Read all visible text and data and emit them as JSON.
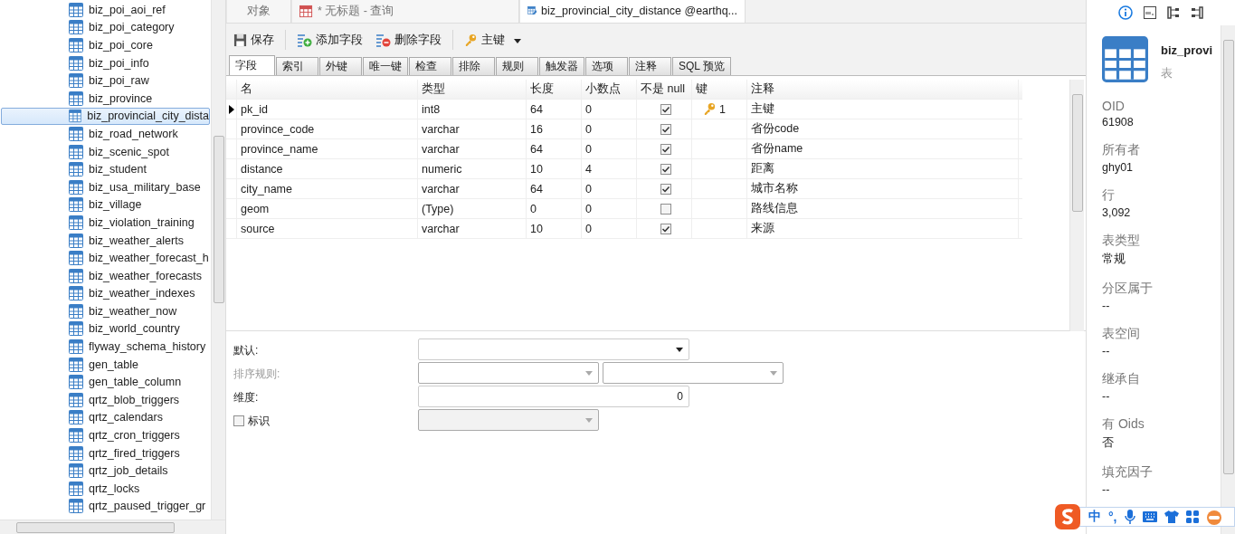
{
  "sidebar": {
    "items": [
      {
        "label": "biz_poi_aoi_ref",
        "selected": false
      },
      {
        "label": "biz_poi_category",
        "selected": false
      },
      {
        "label": "biz_poi_core",
        "selected": false
      },
      {
        "label": "biz_poi_info",
        "selected": false
      },
      {
        "label": "biz_poi_raw",
        "selected": false
      },
      {
        "label": "biz_province",
        "selected": false
      },
      {
        "label": "biz_provincial_city_dista",
        "selected": true
      },
      {
        "label": "biz_road_network",
        "selected": false
      },
      {
        "label": "biz_scenic_spot",
        "selected": false
      },
      {
        "label": "biz_student",
        "selected": false
      },
      {
        "label": "biz_usa_military_base",
        "selected": false
      },
      {
        "label": "biz_village",
        "selected": false
      },
      {
        "label": "biz_violation_training",
        "selected": false
      },
      {
        "label": "biz_weather_alerts",
        "selected": false
      },
      {
        "label": "biz_weather_forecast_h",
        "selected": false
      },
      {
        "label": "biz_weather_forecasts",
        "selected": false
      },
      {
        "label": "biz_weather_indexes",
        "selected": false
      },
      {
        "label": "biz_weather_now",
        "selected": false
      },
      {
        "label": "biz_world_country",
        "selected": false
      },
      {
        "label": "flyway_schema_history",
        "selected": false
      },
      {
        "label": "gen_table",
        "selected": false
      },
      {
        "label": "gen_table_column",
        "selected": false
      },
      {
        "label": "qrtz_blob_triggers",
        "selected": false
      },
      {
        "label": "qrtz_calendars",
        "selected": false
      },
      {
        "label": "qrtz_cron_triggers",
        "selected": false
      },
      {
        "label": "qrtz_fired_triggers",
        "selected": false
      },
      {
        "label": "qrtz_job_details",
        "selected": false
      },
      {
        "label": "qrtz_locks",
        "selected": false
      },
      {
        "label": "qrtz_paused_trigger_gr",
        "selected": false
      }
    ]
  },
  "doc_tabs": [
    {
      "label": "对象",
      "kind": "plain",
      "selected": false
    },
    {
      "label": "* 无标题 - 查询",
      "kind": "query",
      "selected": false
    },
    {
      "label": "biz_provincial_city_distance @earthq...",
      "kind": "table",
      "selected": true
    }
  ],
  "toolbar": [
    {
      "label": "保存",
      "kind": "save"
    },
    {
      "label": "添加字段",
      "kind": "add"
    },
    {
      "label": "删除字段",
      "kind": "delete"
    },
    {
      "label": "主键",
      "kind": "key"
    }
  ],
  "sub_tabs": [
    {
      "label": "字段",
      "selected": true
    },
    {
      "label": "索引",
      "selected": false
    },
    {
      "label": "外键",
      "selected": false
    },
    {
      "label": "唯一键",
      "selected": false
    },
    {
      "label": "检查",
      "selected": false
    },
    {
      "label": "排除",
      "selected": false
    },
    {
      "label": "规则",
      "selected": false
    },
    {
      "label": "触发器",
      "selected": false
    },
    {
      "label": "选项",
      "selected": false
    },
    {
      "label": "注释",
      "selected": false
    },
    {
      "label": "SQL 预览",
      "selected": false
    }
  ],
  "table": {
    "columns": [
      "名",
      "类型",
      "长度",
      "小数点",
      "不是 null",
      "键",
      "注释"
    ],
    "rows": [
      {
        "name": "pk_id",
        "type": "int8",
        "length": "64",
        "decimals": "0",
        "not_null": true,
        "key": "1",
        "comment": "主键",
        "selected": true
      },
      {
        "name": "province_code",
        "type": "varchar",
        "length": "16",
        "decimals": "0",
        "not_null": true,
        "comment": "省份code",
        "selected": false
      },
      {
        "name": "province_name",
        "type": "varchar",
        "length": "64",
        "decimals": "0",
        "not_null": true,
        "comment": "省份name",
        "selected": false
      },
      {
        "name": "distance",
        "type": "numeric",
        "length": "10",
        "decimals": "4",
        "not_null": true,
        "comment": "距离",
        "selected": false
      },
      {
        "name": "city_name",
        "type": "varchar",
        "length": "64",
        "decimals": "0",
        "not_null": true,
        "comment": "城市名称",
        "selected": false
      },
      {
        "name": "geom",
        "type": "(Type)",
        "length": "0",
        "decimals": "0",
        "not_null": false,
        "comment": "路线信息",
        "selected": false
      },
      {
        "name": "source",
        "type": "varchar",
        "length": "10",
        "decimals": "0",
        "not_null": true,
        "comment": "来源",
        "selected": false
      }
    ]
  },
  "properties": {
    "default_label": "默认:",
    "collation_label": "排序规则:",
    "dimension_label": "维度:",
    "dimension_value": "0",
    "identity_label": "标识",
    "identity_checked": false
  },
  "info_panel": {
    "name": "biz_provi",
    "kind_label": "表",
    "fields": [
      {
        "label": "OID",
        "value": "61908"
      },
      {
        "label": "所有者",
        "value": "ghy01"
      },
      {
        "label": "行",
        "value": "3,092"
      },
      {
        "label": "表类型",
        "value": "常规"
      },
      {
        "label": "分区属于",
        "value": "--"
      },
      {
        "label": "表空间",
        "value": "--"
      },
      {
        "label": "继承自",
        "value": "--"
      },
      {
        "label": "有 Oids",
        "value": "否"
      },
      {
        "label": "填充因子",
        "value": "--"
      }
    ]
  },
  "ime_bar": {
    "mode": "中",
    "punct": "°,"
  }
}
